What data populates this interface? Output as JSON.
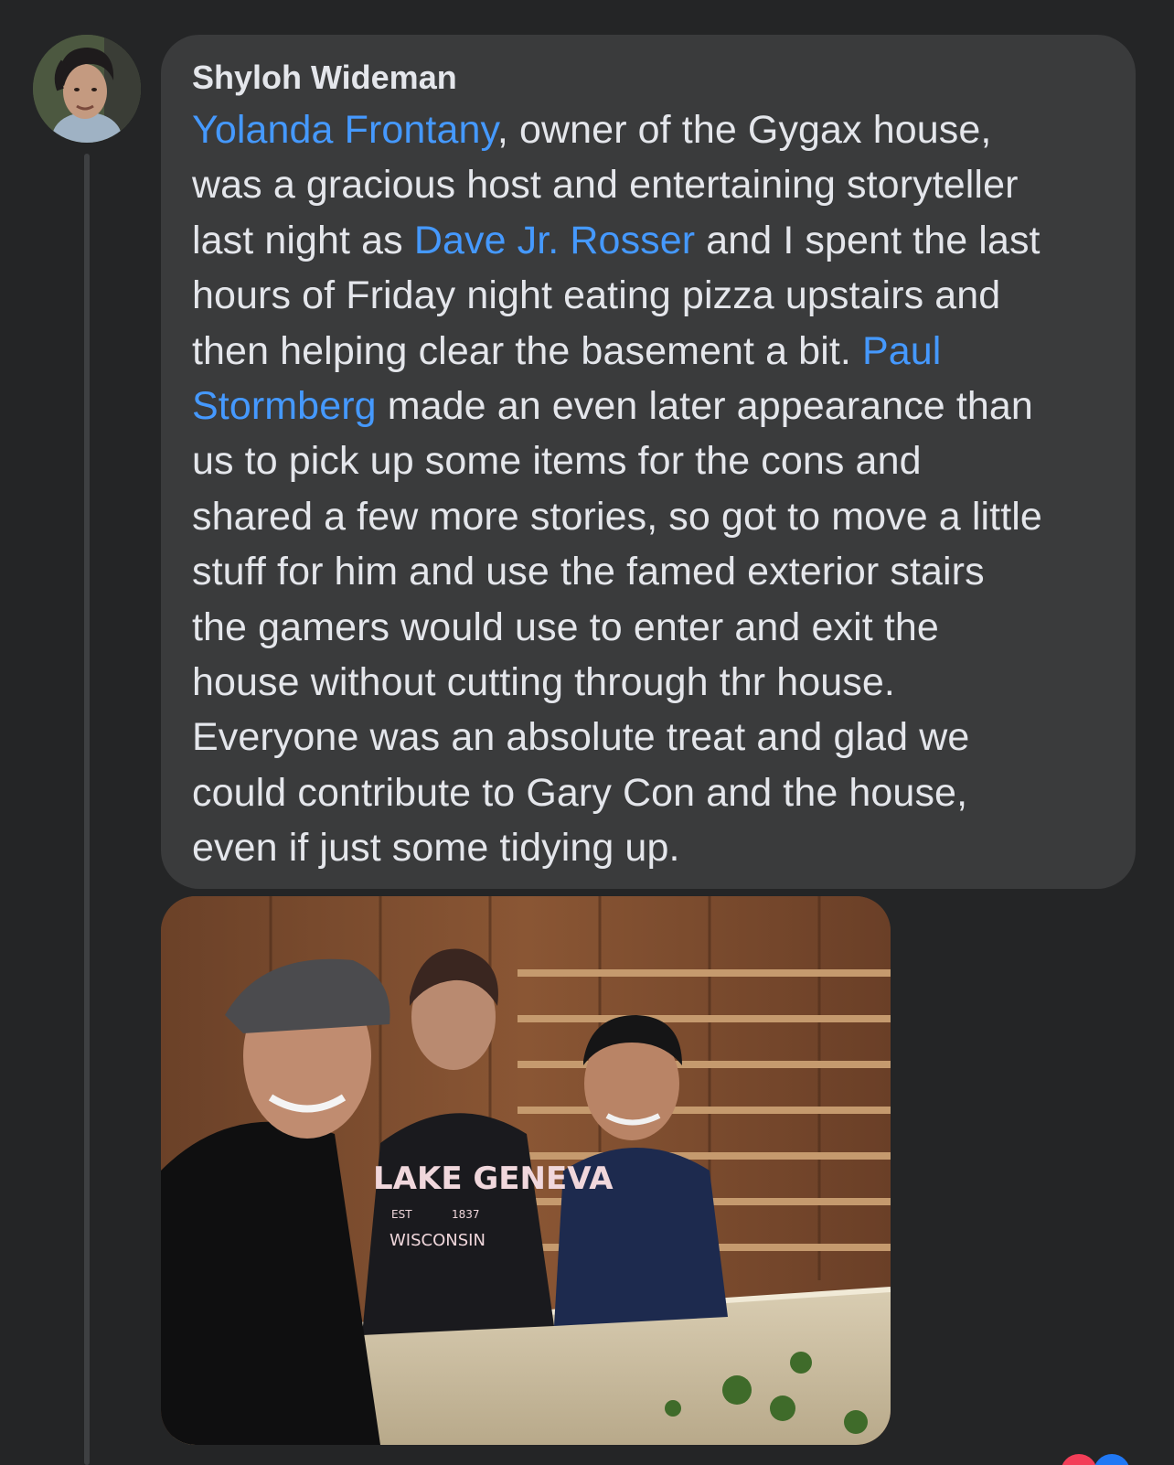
{
  "comment": {
    "author": "Shyloh Wideman",
    "segments": [
      {
        "text": "Yolanda Frontany",
        "mention": true
      },
      {
        "text": ", owner of the Gygax house,",
        "mention": false
      },
      {
        "text": "was a gracious host and entertaining storyteller",
        "mention": false
      },
      {
        "text": "last night as ",
        "mention": false
      },
      {
        "text": "Dave Jr. Rosser",
        "mention": true
      },
      {
        "text": " and I spent the last",
        "mention": false
      },
      {
        "text": "hours of Friday night eating pizza upstairs and",
        "mention": false
      },
      {
        "text": "then helping clear the basement a bit. ",
        "mention": false
      },
      {
        "text": "Paul",
        "mention": true
      },
      {
        "text": "Stormberg",
        "mention": true
      },
      {
        "text": " made an even later appearance than",
        "mention": false
      },
      {
        "text": "us to pick up some items for the cons and",
        "mention": false
      },
      {
        "text": "shared a few more stories, so got to move a little",
        "mention": false
      },
      {
        "text": "stuff for him and use the famed exterior stairs",
        "mention": false
      },
      {
        "text": "the gamers would use to enter and exit the",
        "mention": false
      },
      {
        "text": "house without cutting through thr house.",
        "mention": false
      },
      {
        "text": "Everyone was an absolute treat and glad we",
        "mention": false
      },
      {
        "text": "could contribute to Gary Con and the house,",
        "mention": false
      },
      {
        "text": "even if just some tidying up.",
        "mention": false
      }
    ],
    "photo": {
      "sweatshirt_text_1": "LAKE GENEVA",
      "sweatshirt_text_2": "WISCONSIN",
      "sweatshirt_est": "EST",
      "sweatshirt_year": "1837"
    }
  },
  "colors": {
    "background": "#242526",
    "bubble": "#3a3b3c",
    "text": "#e4e6eb",
    "mention": "#4599ff",
    "thread_line": "#3e4042"
  },
  "icons": {
    "avatar": "profile-photo",
    "reactions": [
      "love-reaction-icon",
      "like-reaction-icon"
    ]
  }
}
